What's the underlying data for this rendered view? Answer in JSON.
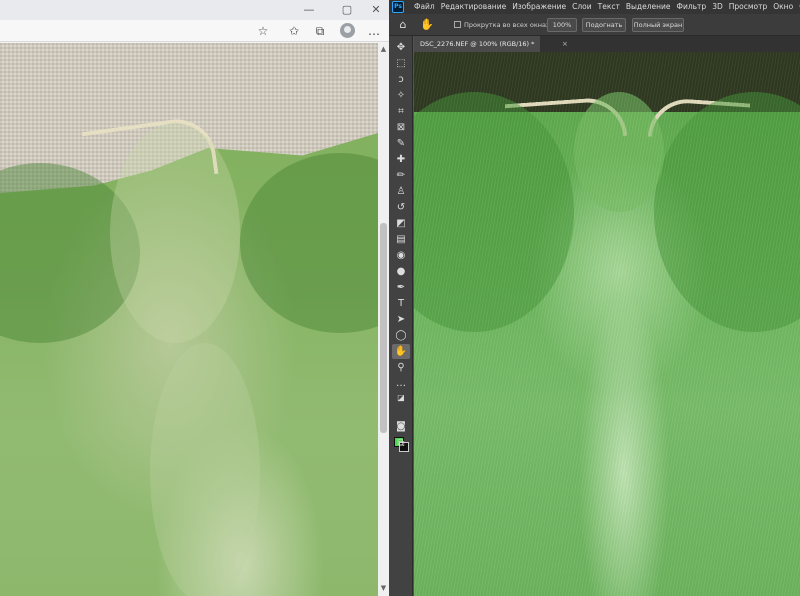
{
  "browser": {
    "window_controls": {
      "minimize_glyph": "—",
      "maximize_glyph": "▢",
      "close_glyph": "✕"
    },
    "toolbar_icons": [
      "read-aloud-icon",
      "favorites-icon",
      "collections-icon",
      "profile-icon",
      "more-icon"
    ],
    "toolbar_glyphs": {
      "read_aloud": "☆",
      "favorites": "✩",
      "collections": "⧉",
      "more": "…"
    },
    "scroll": {
      "up_glyph": "▲",
      "down_glyph": "▼"
    }
  },
  "photoshop": {
    "logo": "Ps",
    "menu": [
      "Файл",
      "Редактирование",
      "Изображение",
      "Слои",
      "Текст",
      "Выделение",
      "Фильтр",
      "3D",
      "Просмотр",
      "Окно",
      "Справка"
    ],
    "options": {
      "home_glyph": "⌂",
      "hand_glyph": "✋",
      "scroll_all_label": "Прокрутка во всех окнах",
      "zoom_100": "100%",
      "fit_label": "Подогнать",
      "fullscreen_label": "Полный экран"
    },
    "document_tab": {
      "title": "DSC_2276.NEF @ 100% (RGB/16) *",
      "close_glyph": "×"
    },
    "tools": [
      {
        "name": "move-tool",
        "glyph": "✥"
      },
      {
        "name": "marquee-tool",
        "glyph": "⬚"
      },
      {
        "name": "lasso-tool",
        "glyph": "ↄ"
      },
      {
        "name": "magic-wand-tool",
        "glyph": "✧"
      },
      {
        "name": "crop-tool",
        "glyph": "⌗"
      },
      {
        "name": "frame-tool",
        "glyph": "⊠"
      },
      {
        "name": "eyedropper-tool",
        "glyph": "✎"
      },
      {
        "name": "healing-tool",
        "glyph": "✚"
      },
      {
        "name": "brush-tool",
        "glyph": "✏"
      },
      {
        "name": "stamp-tool",
        "glyph": "♙"
      },
      {
        "name": "history-brush-tool",
        "glyph": "↺"
      },
      {
        "name": "eraser-tool",
        "glyph": "◩"
      },
      {
        "name": "gradient-tool",
        "glyph": "▤"
      },
      {
        "name": "blur-tool",
        "glyph": "◉"
      },
      {
        "name": "dodge-tool",
        "glyph": "●"
      },
      {
        "name": "pen-tool",
        "glyph": "✒"
      },
      {
        "name": "type-tool",
        "glyph": "T"
      },
      {
        "name": "path-selection-tool",
        "glyph": "➤"
      },
      {
        "name": "shape-tool",
        "glyph": "◯"
      },
      {
        "name": "hand-tool",
        "glyph": "✋"
      },
      {
        "name": "zoom-tool",
        "glyph": "⚲"
      },
      {
        "name": "more-tools",
        "glyph": "…"
      }
    ],
    "tool_glyphs_extra": {
      "default_colors": "◪",
      "swap_colors": "⇆",
      "quick_mask": "◙",
      "screen_mode": "⧉"
    },
    "colors": {
      "foreground": "#4bd84b",
      "background": "#111111"
    }
  }
}
